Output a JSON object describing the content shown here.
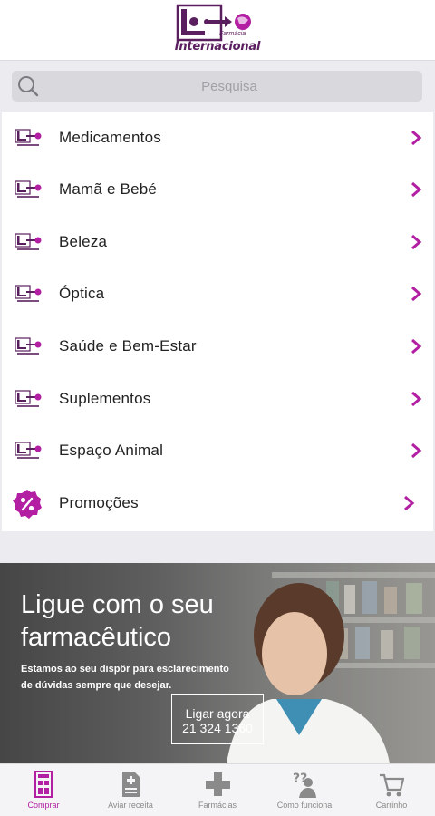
{
  "header": {
    "logo_text": "Internacional",
    "logo_sub": "Farmácia"
  },
  "search": {
    "placeholder": "Pesquisa"
  },
  "menu": {
    "items": [
      {
        "label": "Medicamentos",
        "icon": "pharmacy-logo-icon"
      },
      {
        "label": "Mamã e Bebé",
        "icon": "pharmacy-logo-icon"
      },
      {
        "label": "Beleza",
        "icon": "pharmacy-logo-icon"
      },
      {
        "label": "Óptica",
        "icon": "pharmacy-logo-icon"
      },
      {
        "label": "Saúde e Bem-Estar",
        "icon": "pharmacy-logo-icon"
      },
      {
        "label": "Suplementos",
        "icon": "pharmacy-logo-icon"
      },
      {
        "label": "Espaço Animal",
        "icon": "pharmacy-logo-icon"
      },
      {
        "label": "Promoções",
        "icon": "percent-badge-icon"
      }
    ]
  },
  "banner": {
    "title_line1": "Ligue com o seu",
    "title_line2": "farmacêutico",
    "text": "Estamos ao seu dispôr para esclarecimento de dúvidas sempre que desejar.",
    "call_label": "Ligar agora",
    "call_number": "21 324 1360"
  },
  "nav": {
    "items": [
      {
        "label": "Comprar",
        "icon": "shop-icon",
        "active": true
      },
      {
        "label": "Aviar receita",
        "icon": "prescription-icon",
        "active": false
      },
      {
        "label": "Farmácias",
        "icon": "pharmacy-cross-icon",
        "active": false
      },
      {
        "label": "Como funciona",
        "icon": "help-person-icon",
        "active": false
      },
      {
        "label": "Carrinho",
        "icon": "cart-icon",
        "active": false
      }
    ]
  },
  "colors": {
    "accent": "#b21fa3",
    "brand": "#5a1f5e",
    "text": "#222222",
    "inactive": "#8a8a8a"
  }
}
